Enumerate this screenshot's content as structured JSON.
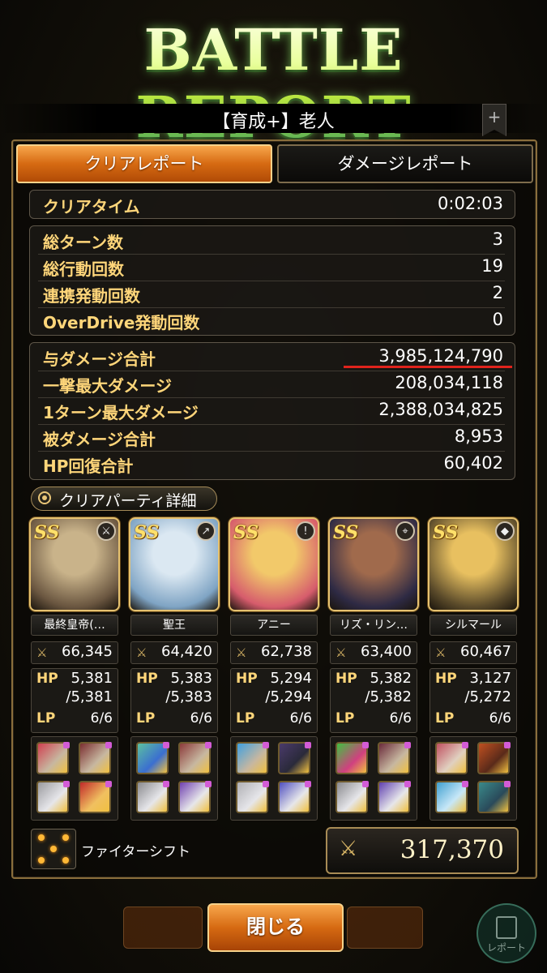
{
  "screen": {
    "title": "BATTLE REPORT",
    "quest_name": "【育成+】老人",
    "bookmark_symbol": "+"
  },
  "tabs": [
    {
      "label": "クリアレポート",
      "active": true
    },
    {
      "label": "ダメージレポート",
      "active": false
    }
  ],
  "clear_time": {
    "label": "クリアタイム",
    "value": "0:02:03"
  },
  "counts": [
    {
      "label": "総ターン数",
      "value": "3"
    },
    {
      "label": "総行動回数",
      "value": "19"
    },
    {
      "label": "連携発動回数",
      "value": "2"
    },
    {
      "label": "OverDrive発動回数",
      "value": "0"
    }
  ],
  "damage": [
    {
      "label": "与ダメージ合計",
      "value": "3,985,124,790"
    },
    {
      "label": "一撃最大ダメージ",
      "value": "208,034,118"
    },
    {
      "label": "1ターン最大ダメージ",
      "value": "2,388,034,825"
    },
    {
      "label": "被ダメージ合計",
      "value": "8,953"
    },
    {
      "label": "HP回復合計",
      "value": "60,402"
    }
  ],
  "party_header": "クリアパーティ詳細",
  "stat_labels": {
    "hp": "HP",
    "lp": "LP"
  },
  "rank_badge": "SS",
  "party": [
    {
      "name": "最終皇帝(…",
      "power": "66,345",
      "hp": "5,381",
      "hp_max": "/5,381",
      "lp": "6/6",
      "weapon_icon": "sword-icon",
      "weapon_glyph": "⚔",
      "portrait_colors": [
        "#c9b38a",
        "#6a5640"
      ]
    },
    {
      "name": "聖王",
      "power": "64,420",
      "hp": "5,383",
      "hp_max": "/5,383",
      "lp": "6/6",
      "weapon_icon": "spear-icon",
      "weapon_glyph": "↗",
      "portrait_colors": [
        "#dbe8f2",
        "#7fa4c4"
      ]
    },
    {
      "name": "アニー",
      "power": "62,738",
      "hp": "5,294",
      "hp_max": "/5,294",
      "lp": "6/6",
      "weapon_icon": "dagger-icon",
      "weapon_glyph": "!",
      "portrait_colors": [
        "#f2c96a",
        "#d65c6c"
      ]
    },
    {
      "name": "リズ・リン…",
      "power": "63,400",
      "hp": "5,382",
      "hp_max": "/5,382",
      "lp": "6/6",
      "weapon_icon": "bow-icon",
      "weapon_glyph": "⌖",
      "portrait_colors": [
        "#a06a4c",
        "#2e2a44"
      ]
    },
    {
      "name": "シルマール",
      "power": "60,467",
      "hp": "3,127",
      "hp_max": "/5,272",
      "lp": "6/6",
      "weapon_icon": "staff-icon",
      "weapon_glyph": "◆",
      "portrait_colors": [
        "#e8c060",
        "#5a4a2a"
      ]
    }
  ],
  "equipment": [
    [
      {
        "icon": "weapon-icon",
        "c1": "#d04050",
        "c2": "#c7b7a0"
      },
      {
        "icon": "armor-icon",
        "c1": "#7b2e30",
        "c2": "#c7b7a0"
      },
      {
        "icon": "gauntlet-icon",
        "c1": "#9a9a9e",
        "c2": "#e6e6ea"
      },
      {
        "icon": "accessory-icon",
        "c1": "#c22a2a",
        "c2": "#f0c060"
      }
    ],
    [
      {
        "icon": "weapon-icon",
        "c1": "#5bc0a0",
        "c2": "#3b6fd0"
      },
      {
        "icon": "armor-icon",
        "c1": "#8c3a3a",
        "c2": "#c7b7a0"
      },
      {
        "icon": "gauntlet-icon",
        "c1": "#8a8a8e",
        "c2": "#e6e6ea"
      },
      {
        "icon": "accessory-icon",
        "c1": "#7040b0",
        "c2": "#e6e6ea"
      }
    ],
    [
      {
        "icon": "weapon-icon",
        "c1": "#3fa0e0",
        "c2": "#c7b7a0"
      },
      {
        "icon": "armor-icon",
        "c1": "#4a3a6a",
        "c2": "#2a2a3a"
      },
      {
        "icon": "gauntlet-icon",
        "c1": "#b0b0b4",
        "c2": "#e6e6ea"
      },
      {
        "icon": "accessory-icon",
        "c1": "#5050c0",
        "c2": "#e6e6ea"
      }
    ],
    [
      {
        "icon": "weapon-icon",
        "c1": "#40c040",
        "c2": "#d04080"
      },
      {
        "icon": "armor-icon",
        "c1": "#6a2a3a",
        "c2": "#c7b7a0"
      },
      {
        "icon": "gauntlet-icon",
        "c1": "#8a8a8e",
        "c2": "#e6e6ea"
      },
      {
        "icon": "accessory-icon",
        "c1": "#6040b0",
        "c2": "#e6e6ea"
      }
    ],
    [
      {
        "icon": "weapon-icon",
        "c1": "#c05060",
        "c2": "#e0d0c0"
      },
      {
        "icon": "armor-icon",
        "c1": "#c05020",
        "c2": "#5a2a1a"
      },
      {
        "icon": "gauntlet-icon",
        "c1": "#40a0d0",
        "c2": "#c7e7f7"
      },
      {
        "icon": "accessory-icon",
        "c1": "#3a8a8a",
        "c2": "#2a4a5a"
      }
    ]
  ],
  "formation": {
    "label": "ファイターシフト"
  },
  "total_power": "317,370",
  "close_button": "閉じる",
  "report_button": "レポート",
  "colors": {
    "accent_orange": "#d66a12",
    "label_gold": "#ffd67a",
    "highlight_red": "#e0231c"
  }
}
